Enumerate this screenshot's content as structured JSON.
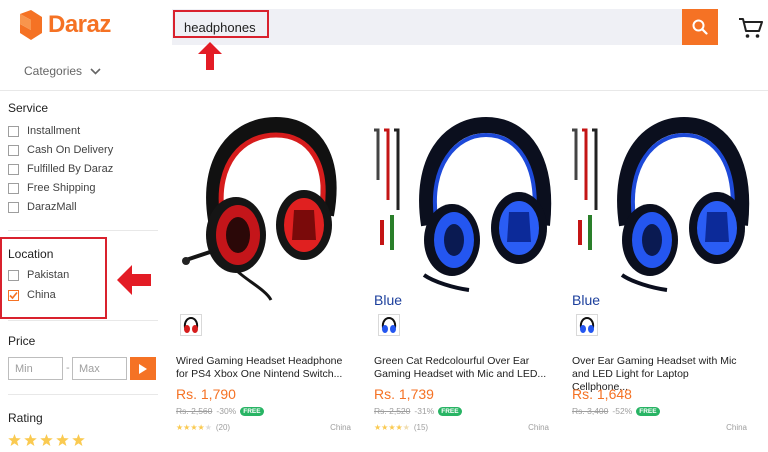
{
  "header": {
    "logo_text": "Daraz",
    "search_value": "headphones",
    "categories_label": "Categories",
    "brand_color": "#f57224"
  },
  "sidebar": {
    "service_title": "Service",
    "service_items": [
      "Installment",
      "Cash On Delivery",
      "Fulfilled By Daraz",
      "Free Shipping",
      "DarazMall"
    ],
    "location_title": "Location",
    "location_items": [
      {
        "label": "Pakistan",
        "checked": false
      },
      {
        "label": "China",
        "checked": true
      }
    ],
    "price_title": "Price",
    "price_min_placeholder": "Min",
    "price_separator": "-",
    "price_max_placeholder": "Max",
    "rating_title": "Rating",
    "rating_stars": 5
  },
  "products": [
    {
      "title_line1": "Wired Gaming Headset Headphone",
      "title_line2": "for PS4 Xbox One Nintend Switch...",
      "price": "Rs. 1,790",
      "old_price": "Rs. 2,560",
      "discount": "-30%",
      "free_label": "FREE",
      "stars": 3.5,
      "reviews": "(20)",
      "country": "China",
      "color_label": "",
      "variant": "red"
    },
    {
      "title_line1": "Green Cat Redcolourful Over Ear",
      "title_line2": "Gaming Headset with Mic and LED...",
      "price": "Rs. 1,739",
      "old_price": "Rs. 2,520",
      "discount": "-31%",
      "free_label": "FREE",
      "stars": 4.5,
      "reviews": "(15)",
      "country": "China",
      "color_label": "Blue",
      "variant": "blue"
    },
    {
      "title_line1": "Over Ear Gaming Headset with Mic",
      "title_line2": "and LED Light for Laptop Cellphone...",
      "price": "Rs. 1,648",
      "old_price": "Rs. 3,400",
      "discount": "-52%",
      "free_label": "FREE",
      "stars": 0,
      "reviews": "",
      "country": "China",
      "color_label": "Blue",
      "variant": "blue"
    }
  ]
}
